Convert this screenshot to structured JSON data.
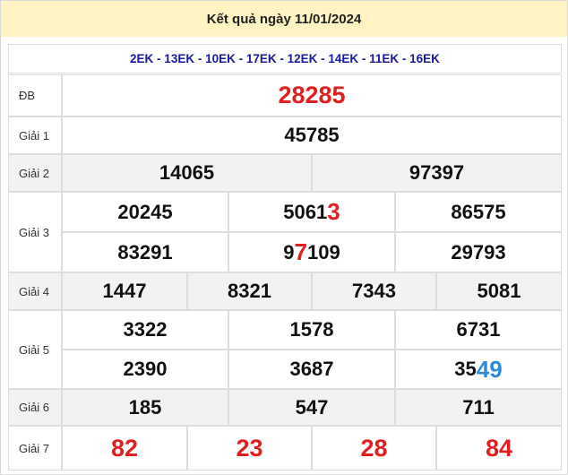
{
  "header": {
    "title": "Kết quả ngày 11/01/2024"
  },
  "series_codes": "2EK - 13EK - 10EK - 17EK - 12EK - 14EK - 11EK - 16EK",
  "prizes": {
    "db": {
      "label": "ĐB",
      "numbers": [
        "28285"
      ]
    },
    "g1": {
      "label": "Giải 1",
      "numbers": [
        "45785"
      ]
    },
    "g2": {
      "label": "Giải 2",
      "numbers": [
        "14065",
        "97397"
      ]
    },
    "g3": {
      "label": "Giải 3",
      "numbers": [
        {
          "main": "5061",
          "accent": "3"
        }
      ],
      "plain": [
        "20245",
        "86575",
        "83291",
        "29793"
      ],
      "mid2": {
        "pre": "9",
        "accent": "7",
        "post": "109"
      }
    },
    "g4": {
      "label": "Giải 4",
      "numbers": [
        "1447",
        "8321",
        "7343",
        "5081"
      ]
    },
    "g5": {
      "label": "Giải 5",
      "numbers": [
        "3322",
        "1578",
        "6731",
        "2390",
        "3687"
      ],
      "last": {
        "main": "35",
        "accent": "49"
      }
    },
    "g6": {
      "label": "Giải 6",
      "numbers": [
        "185",
        "547",
        "711"
      ]
    },
    "g7": {
      "label": "Giải 7",
      "numbers": [
        "82",
        "23",
        "28",
        "84"
      ]
    }
  },
  "colors": {
    "title_bg": "#fff3c4",
    "accent_red": "#e02020",
    "accent_blue": "#2f8ad9",
    "series_text": "#1a1a9e"
  }
}
